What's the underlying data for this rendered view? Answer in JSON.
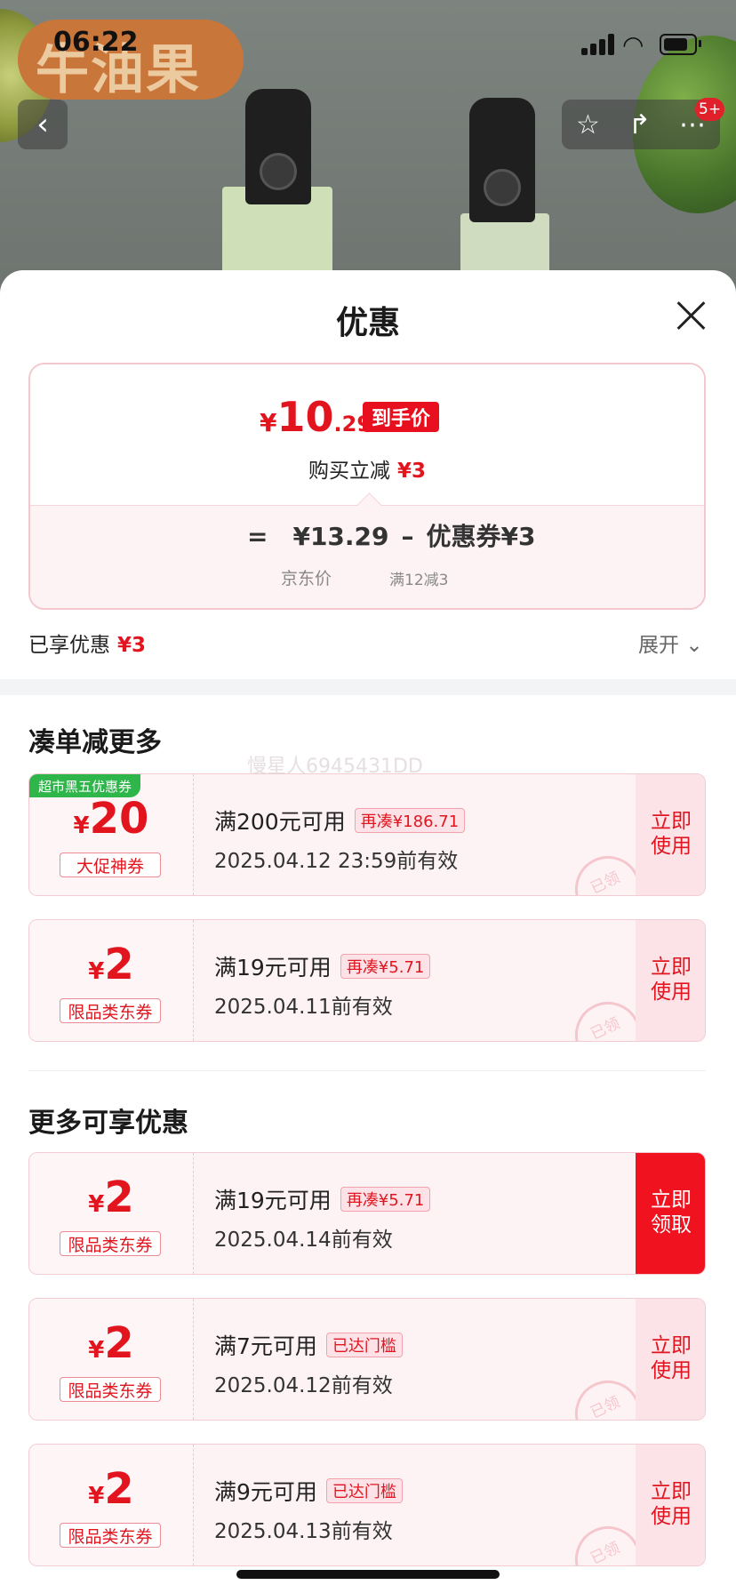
{
  "status_bar": {
    "time": "06:22"
  },
  "hero": {
    "brand": "牛油果",
    "badge": "5+"
  },
  "sheet": {
    "title": "优惠",
    "price": {
      "currency": "¥",
      "integer": "10",
      "decimal": ".29",
      "tag": "到手价"
    },
    "instant": {
      "label": "购买立减",
      "amount": "¥3"
    },
    "formula": {
      "eq": "=",
      "base": "¥13.29",
      "minus": "–",
      "coupon": "优惠券¥3",
      "base_label": "京东价",
      "coupon_label": "满12减3"
    },
    "enjoyed": {
      "label": "已享优惠",
      "amount": "¥3"
    },
    "expand": "展开"
  },
  "section1": {
    "title": "凑单减更多",
    "watermark": "慢星人6945431DD"
  },
  "section2": {
    "title": "更多可享优惠"
  },
  "coupons": [
    {
      "ribbon": "超市黑五优惠券",
      "cur": "¥",
      "amount": "20",
      "type": "大促神券",
      "condition": "满200元可用",
      "tag": "再凑¥186.71",
      "date": "2025.04.12 23:59前有效",
      "button": "立即使用",
      "stamp": "已领"
    },
    {
      "cur": "¥",
      "amount": "2",
      "type": "限品类东券",
      "condition": "满19元可用",
      "tag": "再凑¥5.71",
      "date": "2025.04.11前有效",
      "button": "立即使用",
      "stamp": "已领"
    },
    {
      "cur": "¥",
      "amount": "2",
      "type": "限品类东券",
      "condition": "满19元可用",
      "tag": "再凑¥5.71",
      "date": "2025.04.14前有效",
      "button": "立即领取"
    },
    {
      "cur": "¥",
      "amount": "2",
      "type": "限品类东券",
      "condition": "满7元可用",
      "tag": "已达门槛",
      "date": "2025.04.12前有效",
      "button": "立即使用",
      "stamp": "已领"
    },
    {
      "cur": "¥",
      "amount": "2",
      "type": "限品类东券",
      "condition": "满9元可用",
      "tag": "已达门槛",
      "date": "2025.04.13前有效",
      "button": "立即使用",
      "stamp": "已领"
    }
  ],
  "colors": {
    "accent_red": "#e2151f",
    "button_red": "#f0121e",
    "ribbon_green": "#2fb64a"
  }
}
